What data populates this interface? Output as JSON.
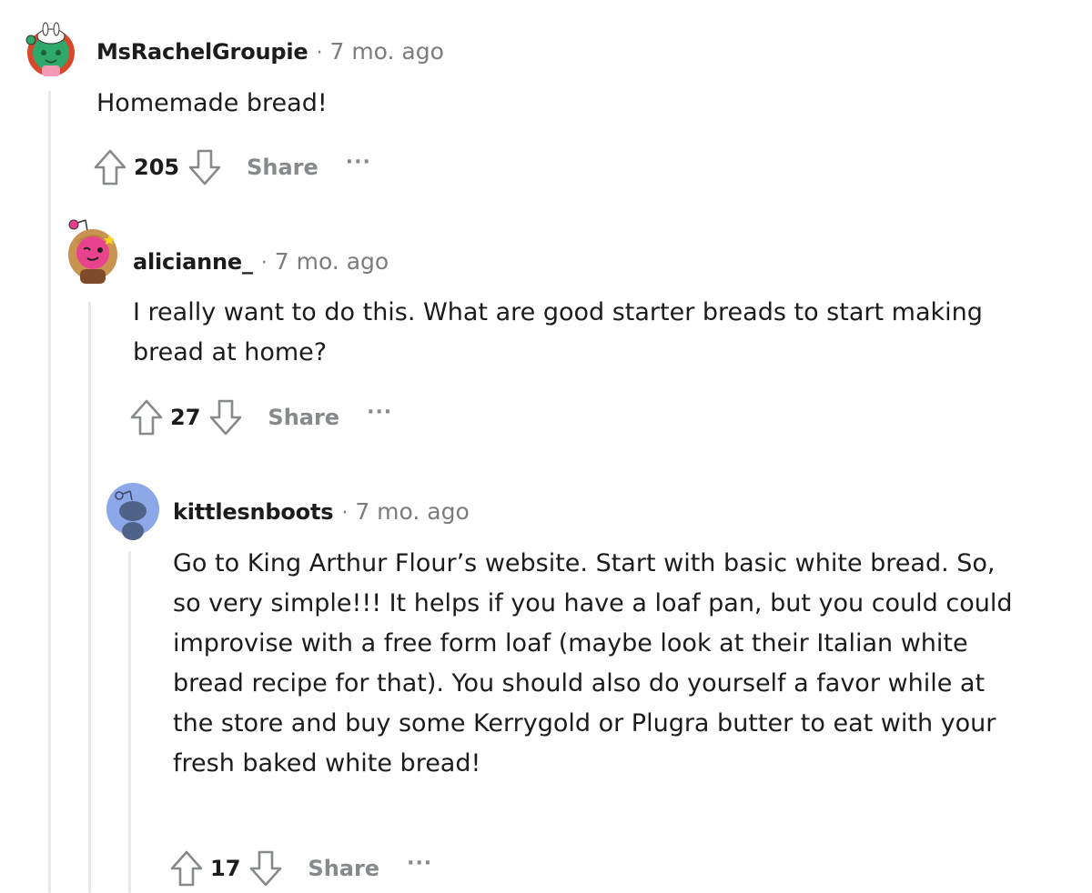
{
  "comments": [
    {
      "username": "MsRachelGroupie",
      "separator": "·",
      "time": "7 mo. ago",
      "body": [
        "Homemade bread!"
      ],
      "score": "205",
      "share_label": "Share",
      "more_label": "···"
    },
    {
      "username": "alicianne_",
      "separator": "·",
      "time": "7 mo. ago",
      "body": [
        "I really want to do this. What are good starter breads to start making",
        "bread at home?"
      ],
      "score": "27",
      "share_label": "Share",
      "more_label": "···"
    },
    {
      "username": "kittlesnboots",
      "separator": "·",
      "time": "7 mo. ago",
      "body": [
        "Go to King Arthur Flour’s website. Start with basic white bread. So,",
        "so very simple!!! It helps if you have a loaf pan, but you could could",
        "improvise with a free form loaf (maybe look at their Italian white",
        "bread recipe for that). You should also do yourself a favor while at",
        "the store and buy some Kerrygold or Plugra butter to eat with your",
        "fresh baked white bread!"
      ],
      "score": "17",
      "share_label": "Share",
      "more_label": "···"
    }
  ],
  "colors": {
    "text": "#1c1c1c",
    "muted": "#7c7c7c",
    "action": "#878a8c",
    "thread_line": "#e8e8e8",
    "default_avatar_bg": "#8da8e8"
  },
  "icons": [
    "upvote-arrow-icon",
    "downvote-arrow-icon",
    "more-options-icon"
  ]
}
